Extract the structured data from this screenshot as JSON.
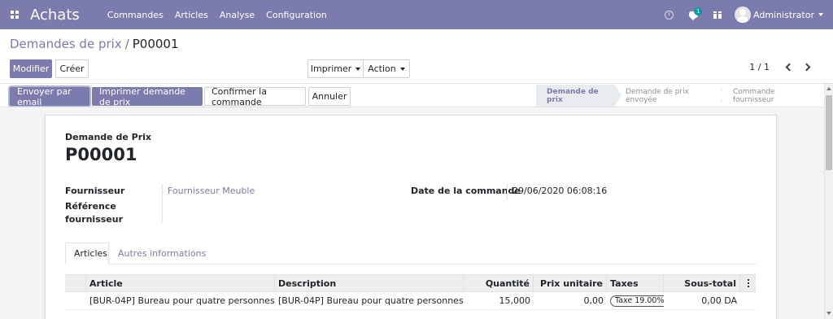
{
  "navbar": {
    "app_title": "Achats",
    "menu": [
      "Commandes",
      "Articles",
      "Analyse",
      "Configuration"
    ],
    "notification_count": "1",
    "user_name": "Administrator",
    "icons": [
      "apps-icon",
      "clock-icon",
      "chat-icon",
      "gift-icon",
      "avatar"
    ]
  },
  "breadcrumb": {
    "parent": "Demandes de prix",
    "separator": "/",
    "current": "P00001"
  },
  "control_panel": {
    "edit_label": "Modifier",
    "create_label": "Créer",
    "print_label": "Imprimer",
    "action_label": "Action",
    "pager_value": "1 / 1"
  },
  "statusbar": {
    "buttons": [
      "Envoyer par email",
      "Imprimer demande de prix",
      "Confirmer la commande",
      "Annuler"
    ],
    "stages": [
      "Demande de prix",
      "Demande de prix envoyée",
      "Commande fournisseur"
    ],
    "active_stage": "Demande de prix"
  },
  "form": {
    "doc_type": "Demande de Prix",
    "doc_name": "P00001",
    "vendor_label": "Fournisseur",
    "vendor_value": "Fournisseur Meuble",
    "vendor_ref_label_line1": "Référence",
    "vendor_ref_label_line2": "fournisseur",
    "order_date_label": "Date de la commande",
    "order_date_value": "29/06/2020 06:08:16"
  },
  "tabs": [
    "Articles",
    "Autres informations"
  ],
  "table": {
    "columns": [
      "Article",
      "Description",
      "Quantité",
      "Prix unitaire",
      "Taxes",
      "Sous-total"
    ],
    "rows": [
      {
        "article": "[BUR-04P] Bureau pour quatre personnes",
        "description": "[BUR-04P] Bureau pour quatre personnes",
        "quantity": "15,000",
        "unit_price": "0,00",
        "taxes": "Taxe 19.00%",
        "subtotal": "0,00 DA"
      }
    ]
  },
  "colors": {
    "brand": "#7c7bad",
    "sheet_bg": "#f4f4f4"
  }
}
